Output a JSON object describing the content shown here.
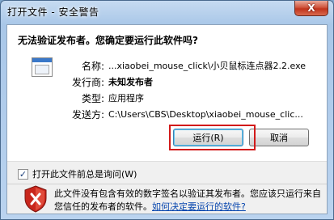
{
  "window": {
    "title": "打开文件 - 安全警告",
    "close_glyph": "X"
  },
  "dialog": {
    "question": "无法验证发布者。您确定要运行此软件吗?",
    "fields": {
      "name_label": "名称:",
      "name_value": "...xiaobei_mouse_click\\小贝鼠标连点器2.2.exe",
      "publisher_label": "发行商:",
      "publisher_value": "未知发布者",
      "type_label": "类型:",
      "type_value": "应用程序",
      "from_label": "发送方:",
      "from_value": "C:\\Users\\CBS\\Desktop\\xiaobei_mouse_clic..."
    },
    "run_button": "运行(R)",
    "cancel_button": "取消",
    "checkbox_label": "打开此文件前总是询问(W)",
    "checkbox_checked": true,
    "checkbox_mark": "✓",
    "warning_text": "此文件没有包含有效的数字签名以验证其发布者。您应该只运行来自您信任的发布者的软件。",
    "warning_link": "如何决定要运行的软件?"
  },
  "colors": {
    "highlight_border": "#d21a1a",
    "link": "#0645ad"
  }
}
